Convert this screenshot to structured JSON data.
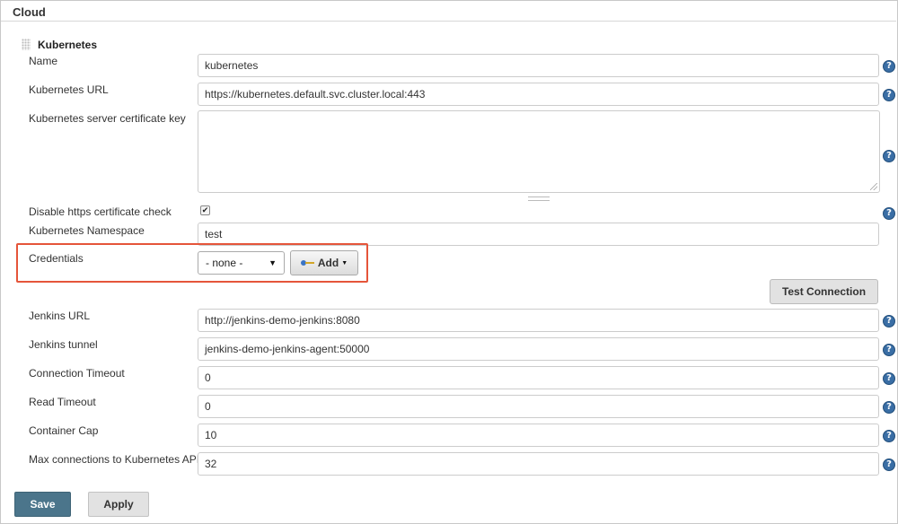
{
  "section": {
    "title": "Cloud"
  },
  "cloud": {
    "title": "Kubernetes",
    "fields": {
      "name": {
        "label": "Name",
        "value": "kubernetes"
      },
      "kubernetes_url": {
        "label": "Kubernetes URL",
        "value": "https://kubernetes.default.svc.cluster.local:443"
      },
      "server_cert_key": {
        "label": "Kubernetes server certificate key",
        "value": ""
      },
      "disable_https_check": {
        "label": "Disable https certificate check",
        "checked": true
      },
      "namespace": {
        "label": "Kubernetes Namespace",
        "value": "test"
      },
      "credentials": {
        "label": "Credentials",
        "selected": "- none -",
        "add_label": "Add"
      },
      "jenkins_url": {
        "label": "Jenkins URL",
        "value": "http://jenkins-demo-jenkins:8080"
      },
      "jenkins_tunnel": {
        "label": "Jenkins tunnel",
        "value": "jenkins-demo-jenkins-agent:50000"
      },
      "connection_timeout": {
        "label": "Connection Timeout",
        "value": "0"
      },
      "read_timeout": {
        "label": "Read Timeout",
        "value": "0"
      },
      "container_cap": {
        "label": "Container Cap",
        "value": "10"
      },
      "max_connections": {
        "label": "Max connections to Kubernetes API",
        "value": "32"
      }
    },
    "test_connection_label": "Test Connection"
  },
  "footer": {
    "save_label": "Save",
    "apply_label": "Apply"
  },
  "icons": {
    "help": "?",
    "check": "✔",
    "caret": "▼"
  },
  "colors": {
    "highlight": "#e5553a",
    "save_button": "#4b758b",
    "help_icon": "#3a6ea5"
  }
}
